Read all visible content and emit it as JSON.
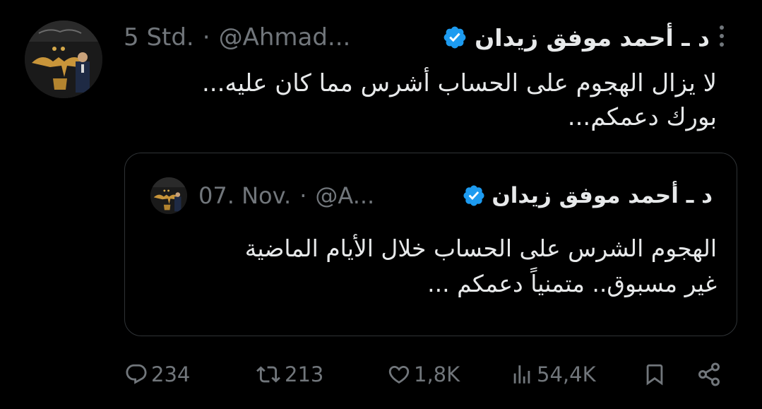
{
  "tweet": {
    "author": {
      "display_name": "د ـ أحمد موفق زيدان",
      "handle": "@Ahmad...",
      "verified": true
    },
    "separator": "·",
    "time": "5 Std.",
    "text_lines": [
      "لا يزال الهجوم على الحساب أشرس مما كان عليه...",
      "بورك دعمكم..."
    ],
    "more_icon": "more-vertical-icon"
  },
  "quoted": {
    "author": {
      "display_name": "د ـ أحمد موفق زيدان",
      "handle": "@A...",
      "verified": true
    },
    "separator": "·",
    "time": "07. Nov.",
    "text_lines": [
      "الهجوم الشرس على الحساب خلال الأيام الماضية",
      "غير مسبوق.. متمنياً دعمكم ..."
    ]
  },
  "actions": {
    "replies": {
      "icon": "reply-icon",
      "count": "234"
    },
    "reposts": {
      "icon": "repost-icon",
      "count": "213"
    },
    "likes": {
      "icon": "heart-icon",
      "count": "1,8K"
    },
    "views": {
      "icon": "views-icon",
      "count": "54,4K"
    },
    "bookmark": {
      "icon": "bookmark-icon"
    },
    "share": {
      "icon": "share-icon"
    }
  },
  "colors": {
    "background": "#000000",
    "text": "#e7e9ea",
    "secondary": "#71767b",
    "verified": "#1d9bf0",
    "border": "#2f3336"
  }
}
